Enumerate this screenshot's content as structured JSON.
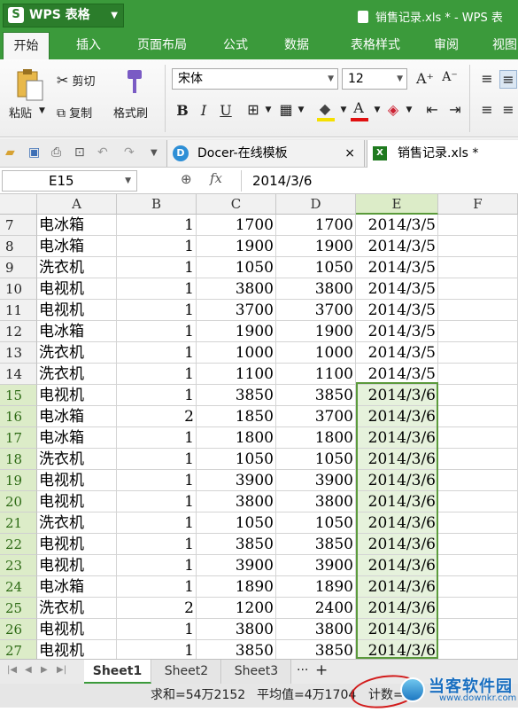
{
  "app": {
    "name": "WPS 表格",
    "logo_letter": "S",
    "doc_title": "销售记录.xls * - WPS 表"
  },
  "menu_tabs": [
    "开始",
    "插入",
    "页面布局",
    "公式",
    "数据",
    "表格样式",
    "审阅",
    "视图"
  ],
  "ribbon": {
    "paste": "粘贴",
    "cut": "剪切",
    "copy": "复制",
    "format_painter": "格式刷",
    "font_name": "宋体",
    "font_size": "12",
    "bold": "B",
    "italic": "I",
    "underline": "U",
    "grow_font": "A⁺",
    "shrink_font": "A⁻",
    "font_color_letter": "A"
  },
  "doc_tabs": [
    {
      "label": "Docer-在线模板",
      "close": "×"
    },
    {
      "label": "销售记录.xls *"
    }
  ],
  "formula_bar": {
    "cell_ref": "E15",
    "fx": "fx",
    "value": "2014/3/6"
  },
  "columns": [
    "A",
    "B",
    "C",
    "D",
    "E",
    "F"
  ],
  "rows": [
    {
      "n": "7",
      "a": "电冰箱",
      "b": "1",
      "c": "1700",
      "d": "1700",
      "e": "2014/3/5"
    },
    {
      "n": "8",
      "a": "电冰箱",
      "b": "1",
      "c": "1900",
      "d": "1900",
      "e": "2014/3/5"
    },
    {
      "n": "9",
      "a": "洗衣机",
      "b": "1",
      "c": "1050",
      "d": "1050",
      "e": "2014/3/5"
    },
    {
      "n": "10",
      "a": "电视机",
      "b": "1",
      "c": "3800",
      "d": "3800",
      "e": "2014/3/5"
    },
    {
      "n": "11",
      "a": "电视机",
      "b": "1",
      "c": "3700",
      "d": "3700",
      "e": "2014/3/5"
    },
    {
      "n": "12",
      "a": "电冰箱",
      "b": "1",
      "c": "1900",
      "d": "1900",
      "e": "2014/3/5"
    },
    {
      "n": "13",
      "a": "洗衣机",
      "b": "1",
      "c": "1000",
      "d": "1000",
      "e": "2014/3/5"
    },
    {
      "n": "14",
      "a": "洗衣机",
      "b": "1",
      "c": "1100",
      "d": "1100",
      "e": "2014/3/5"
    },
    {
      "n": "15",
      "a": "电视机",
      "b": "1",
      "c": "3850",
      "d": "3850",
      "e": "2014/3/6"
    },
    {
      "n": "16",
      "a": "电冰箱",
      "b": "2",
      "c": "1850",
      "d": "3700",
      "e": "2014/3/6"
    },
    {
      "n": "17",
      "a": "电冰箱",
      "b": "1",
      "c": "1800",
      "d": "1800",
      "e": "2014/3/6"
    },
    {
      "n": "18",
      "a": "洗衣机",
      "b": "1",
      "c": "1050",
      "d": "1050",
      "e": "2014/3/6"
    },
    {
      "n": "19",
      "a": "电视机",
      "b": "1",
      "c": "3900",
      "d": "3900",
      "e": "2014/3/6"
    },
    {
      "n": "20",
      "a": "电视机",
      "b": "1",
      "c": "3800",
      "d": "3800",
      "e": "2014/3/6"
    },
    {
      "n": "21",
      "a": "洗衣机",
      "b": "1",
      "c": "1050",
      "d": "1050",
      "e": "2014/3/6"
    },
    {
      "n": "22",
      "a": "电视机",
      "b": "1",
      "c": "3850",
      "d": "3850",
      "e": "2014/3/6"
    },
    {
      "n": "23",
      "a": "电视机",
      "b": "1",
      "c": "3900",
      "d": "3900",
      "e": "2014/3/6"
    },
    {
      "n": "24",
      "a": "电冰箱",
      "b": "1",
      "c": "1890",
      "d": "1890",
      "e": "2014/3/6"
    },
    {
      "n": "25",
      "a": "洗衣机",
      "b": "2",
      "c": "1200",
      "d": "2400",
      "e": "2014/3/6"
    },
    {
      "n": "26",
      "a": "电视机",
      "b": "1",
      "c": "3800",
      "d": "3800",
      "e": "2014/3/6"
    },
    {
      "n": "27",
      "a": "电视机",
      "b": "1",
      "c": "3850",
      "d": "3850",
      "e": "2014/3/6"
    }
  ],
  "selected": {
    "column": "E",
    "first_row": "15",
    "last_row": "27"
  },
  "sheets": [
    "Sheet1",
    "Sheet2",
    "Sheet3"
  ],
  "sheet_more": "···",
  "sheet_add": "+",
  "status": {
    "sum": "求和=54万2152",
    "avg": "平均值=4万1704",
    "count": "计数=13"
  },
  "watermark": {
    "text": "当客软件园",
    "sub": "www.downkr.com"
  },
  "colors": {
    "accent": "#3b9a3b",
    "selection": "#5b9a3c",
    "highlight_oval": "#d21c1c"
  }
}
